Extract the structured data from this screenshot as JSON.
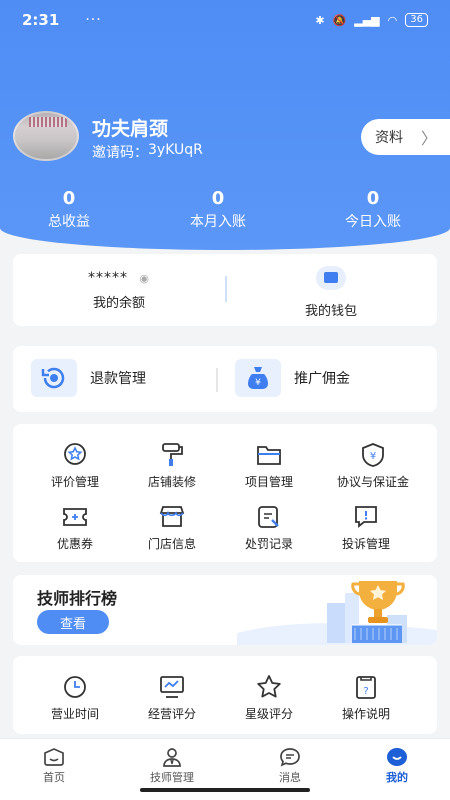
{
  "status_bar": {
    "time": "2:31",
    "dots": "···",
    "battery": "36",
    "net": "HD"
  },
  "profile": {
    "name": "功夫肩颈",
    "invite_label": "邀请码：",
    "invite_code": "3yKUqR",
    "profile_button": "资料"
  },
  "stats": [
    {
      "value": "0",
      "label": "总收益"
    },
    {
      "value": "0",
      "label": "本月入账"
    },
    {
      "value": "0",
      "label": "今日入账"
    }
  ],
  "balance": {
    "masked": "*****",
    "balance_label": "我的余额",
    "wallet_label": "我的钱包"
  },
  "quick": {
    "refund": "退款管理",
    "commission": "推广佣金"
  },
  "grid": [
    {
      "label": "评价管理",
      "icon": "rating-icon"
    },
    {
      "label": "店铺装修",
      "icon": "paint-roller-icon"
    },
    {
      "label": "项目管理",
      "icon": "folder-icon"
    },
    {
      "label": "协议与保证金",
      "icon": "shield-yen-icon"
    },
    {
      "label": "优惠券",
      "icon": "coupon-icon"
    },
    {
      "label": "门店信息",
      "icon": "store-icon"
    },
    {
      "label": "处罚记录",
      "icon": "penalty-icon"
    },
    {
      "label": "投诉管理",
      "icon": "complaint-icon"
    }
  ],
  "ranking": {
    "title": "技师排行榜",
    "button": "查看"
  },
  "bottom_grid": [
    {
      "label": "营业时间",
      "icon": "clock-icon"
    },
    {
      "label": "经营评分",
      "icon": "monitor-chart-icon"
    },
    {
      "label": "星级评分",
      "icon": "star-icon"
    },
    {
      "label": "操作说明",
      "icon": "help-doc-icon"
    }
  ],
  "tabs": [
    {
      "label": "首页"
    },
    {
      "label": "技师管理"
    },
    {
      "label": "消息"
    },
    {
      "label": "我的"
    }
  ],
  "colors": {
    "brand": "#4f8df5",
    "active_tab": "#1d5fd6"
  }
}
